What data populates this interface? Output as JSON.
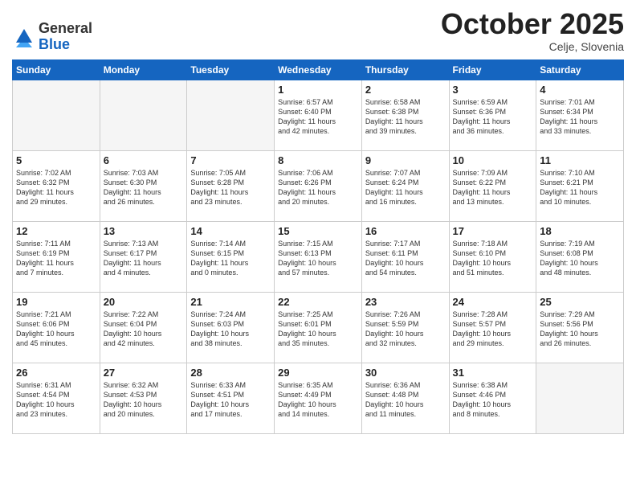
{
  "logo": {
    "general": "General",
    "blue": "Blue"
  },
  "header": {
    "month": "October 2025",
    "location": "Celje, Slovenia"
  },
  "weekdays": [
    "Sunday",
    "Monday",
    "Tuesday",
    "Wednesday",
    "Thursday",
    "Friday",
    "Saturday"
  ],
  "weeks": [
    [
      {
        "day": "",
        "info": ""
      },
      {
        "day": "",
        "info": ""
      },
      {
        "day": "",
        "info": ""
      },
      {
        "day": "1",
        "info": "Sunrise: 6:57 AM\nSunset: 6:40 PM\nDaylight: 11 hours\nand 42 minutes."
      },
      {
        "day": "2",
        "info": "Sunrise: 6:58 AM\nSunset: 6:38 PM\nDaylight: 11 hours\nand 39 minutes."
      },
      {
        "day": "3",
        "info": "Sunrise: 6:59 AM\nSunset: 6:36 PM\nDaylight: 11 hours\nand 36 minutes."
      },
      {
        "day": "4",
        "info": "Sunrise: 7:01 AM\nSunset: 6:34 PM\nDaylight: 11 hours\nand 33 minutes."
      }
    ],
    [
      {
        "day": "5",
        "info": "Sunrise: 7:02 AM\nSunset: 6:32 PM\nDaylight: 11 hours\nand 29 minutes."
      },
      {
        "day": "6",
        "info": "Sunrise: 7:03 AM\nSunset: 6:30 PM\nDaylight: 11 hours\nand 26 minutes."
      },
      {
        "day": "7",
        "info": "Sunrise: 7:05 AM\nSunset: 6:28 PM\nDaylight: 11 hours\nand 23 minutes."
      },
      {
        "day": "8",
        "info": "Sunrise: 7:06 AM\nSunset: 6:26 PM\nDaylight: 11 hours\nand 20 minutes."
      },
      {
        "day": "9",
        "info": "Sunrise: 7:07 AM\nSunset: 6:24 PM\nDaylight: 11 hours\nand 16 minutes."
      },
      {
        "day": "10",
        "info": "Sunrise: 7:09 AM\nSunset: 6:22 PM\nDaylight: 11 hours\nand 13 minutes."
      },
      {
        "day": "11",
        "info": "Sunrise: 7:10 AM\nSunset: 6:21 PM\nDaylight: 11 hours\nand 10 minutes."
      }
    ],
    [
      {
        "day": "12",
        "info": "Sunrise: 7:11 AM\nSunset: 6:19 PM\nDaylight: 11 hours\nand 7 minutes."
      },
      {
        "day": "13",
        "info": "Sunrise: 7:13 AM\nSunset: 6:17 PM\nDaylight: 11 hours\nand 4 minutes."
      },
      {
        "day": "14",
        "info": "Sunrise: 7:14 AM\nSunset: 6:15 PM\nDaylight: 11 hours\nand 0 minutes."
      },
      {
        "day": "15",
        "info": "Sunrise: 7:15 AM\nSunset: 6:13 PM\nDaylight: 10 hours\nand 57 minutes."
      },
      {
        "day": "16",
        "info": "Sunrise: 7:17 AM\nSunset: 6:11 PM\nDaylight: 10 hours\nand 54 minutes."
      },
      {
        "day": "17",
        "info": "Sunrise: 7:18 AM\nSunset: 6:10 PM\nDaylight: 10 hours\nand 51 minutes."
      },
      {
        "day": "18",
        "info": "Sunrise: 7:19 AM\nSunset: 6:08 PM\nDaylight: 10 hours\nand 48 minutes."
      }
    ],
    [
      {
        "day": "19",
        "info": "Sunrise: 7:21 AM\nSunset: 6:06 PM\nDaylight: 10 hours\nand 45 minutes."
      },
      {
        "day": "20",
        "info": "Sunrise: 7:22 AM\nSunset: 6:04 PM\nDaylight: 10 hours\nand 42 minutes."
      },
      {
        "day": "21",
        "info": "Sunrise: 7:24 AM\nSunset: 6:03 PM\nDaylight: 10 hours\nand 38 minutes."
      },
      {
        "day": "22",
        "info": "Sunrise: 7:25 AM\nSunset: 6:01 PM\nDaylight: 10 hours\nand 35 minutes."
      },
      {
        "day": "23",
        "info": "Sunrise: 7:26 AM\nSunset: 5:59 PM\nDaylight: 10 hours\nand 32 minutes."
      },
      {
        "day": "24",
        "info": "Sunrise: 7:28 AM\nSunset: 5:57 PM\nDaylight: 10 hours\nand 29 minutes."
      },
      {
        "day": "25",
        "info": "Sunrise: 7:29 AM\nSunset: 5:56 PM\nDaylight: 10 hours\nand 26 minutes."
      }
    ],
    [
      {
        "day": "26",
        "info": "Sunrise: 6:31 AM\nSunset: 4:54 PM\nDaylight: 10 hours\nand 23 minutes."
      },
      {
        "day": "27",
        "info": "Sunrise: 6:32 AM\nSunset: 4:53 PM\nDaylight: 10 hours\nand 20 minutes."
      },
      {
        "day": "28",
        "info": "Sunrise: 6:33 AM\nSunset: 4:51 PM\nDaylight: 10 hours\nand 17 minutes."
      },
      {
        "day": "29",
        "info": "Sunrise: 6:35 AM\nSunset: 4:49 PM\nDaylight: 10 hours\nand 14 minutes."
      },
      {
        "day": "30",
        "info": "Sunrise: 6:36 AM\nSunset: 4:48 PM\nDaylight: 10 hours\nand 11 minutes."
      },
      {
        "day": "31",
        "info": "Sunrise: 6:38 AM\nSunset: 4:46 PM\nDaylight: 10 hours\nand 8 minutes."
      },
      {
        "day": "",
        "info": ""
      }
    ]
  ]
}
